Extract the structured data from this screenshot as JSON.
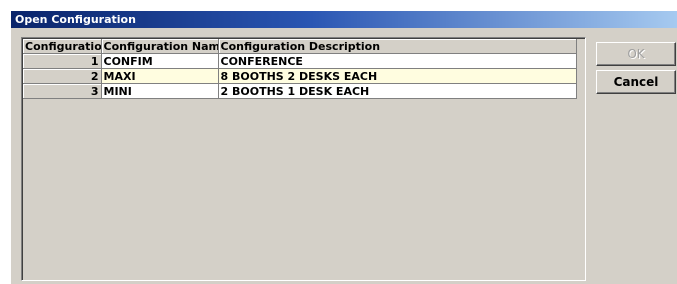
{
  "window": {
    "title": "Open Configuration"
  },
  "table": {
    "headers": [
      "Configuration",
      "Configuration Name",
      "Configuration Description"
    ],
    "rows": [
      {
        "num": "1",
        "name": "CONFIM",
        "description": "CONFERENCE"
      },
      {
        "num": "2",
        "name": "MAXI",
        "description": "8 BOOTHS 2 DESKS EACH"
      },
      {
        "num": "3",
        "name": "MINI",
        "description": "2 BOOTHS 1 DESK EACH"
      }
    ]
  },
  "buttons": {
    "ok_label": "OK",
    "cancel_label": "Cancel"
  },
  "colors": {
    "titlebar_start": "#0a246a",
    "titlebar_end": "#a6caf0",
    "dialog_face": "#d4d0c8",
    "row_highlight": "#fffde0"
  }
}
